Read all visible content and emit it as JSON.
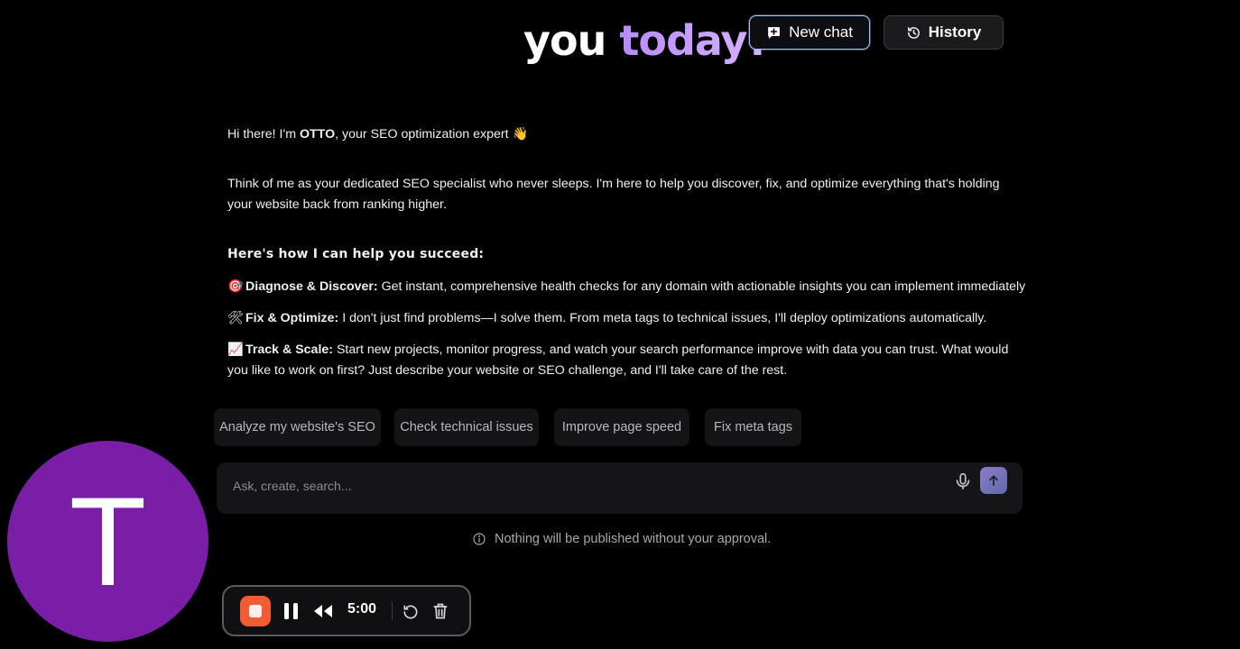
{
  "header": {
    "title_part1": "you",
    "title_part2": "today?",
    "new_chat_label": "New chat",
    "history_label": "History"
  },
  "message": {
    "intro_prefix": "Hi there! I'm ",
    "intro_name": "OTTO",
    "intro_suffix": ", your SEO optimization expert ",
    "intro_emoji": "👋",
    "description": "Think of me as your dedicated SEO specialist who never sleeps. I'm here to help you discover, fix, and optimize everything that's holding your website back from ranking higher.",
    "heading": "Here's how I can help you succeed:",
    "items": [
      {
        "emoji": "🎯",
        "title": "Diagnose & Discover:",
        "text": " Get instant, comprehensive health checks for any domain with actionable insights you can implement immediately"
      },
      {
        "emoji": "🛠",
        "title": "Fix & Optimize:",
        "text": " I don't just find problems—I solve them. From meta tags to technical issues, I'll deploy optimizations automatically."
      },
      {
        "emoji": "📈",
        "title": "Track & Scale:",
        "text": " Start new projects, monitor progress, and watch your search performance improve with data you can trust. What would you like to work on first? Just describe your website or SEO challenge, and I'll take care of the rest."
      }
    ]
  },
  "suggestions": [
    "Analyze my website's SEO",
    "Check technical issues",
    "Improve page speed",
    "Fix meta tags"
  ],
  "composer": {
    "placeholder": "Ask, create, search..."
  },
  "notice": "Nothing will be published without your approval.",
  "avatar": {
    "initial": "T",
    "color": "#7a1ea8"
  },
  "recorder": {
    "time": "5:00",
    "stop_color": "#f35b35"
  },
  "icons": {
    "new_chat": "chat-plus-icon",
    "history": "history-icon",
    "mic": "microphone-icon",
    "send": "arrow-up-icon",
    "info": "info-icon"
  }
}
